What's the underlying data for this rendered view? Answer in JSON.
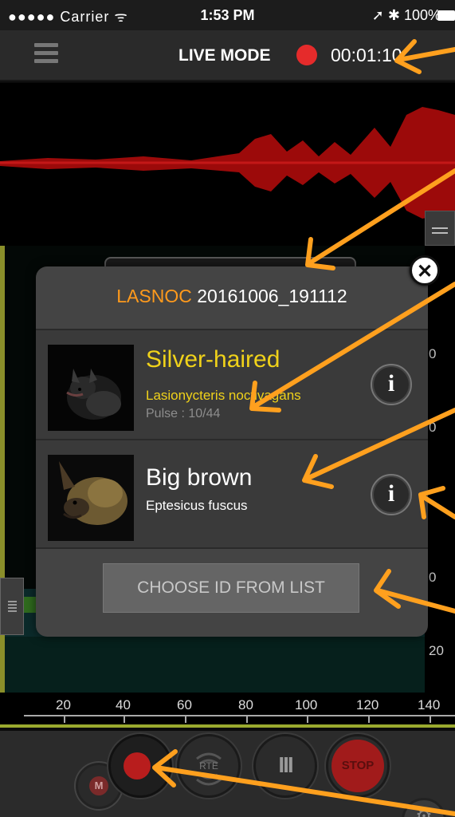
{
  "status_bar": {
    "carrier": "●●●●● Carrier",
    "wifi_glyph": "ᯤ",
    "time": "1:53 PM",
    "right": "➚ ✱ 100%"
  },
  "header": {
    "mode_label": "LIVE MODE",
    "timer": "00:01:10"
  },
  "frequency_scale": [
    "0",
    "0",
    "0",
    "20"
  ],
  "time_axis": [
    "20",
    "40",
    "60",
    "80",
    "100",
    "120",
    "140"
  ],
  "modal": {
    "code": "LASNOC",
    "file": "20161006_191112",
    "close_glyph": "✕",
    "species": [
      {
        "common": "Silver-haired",
        "scientific": "Lasionycteris noctivagans",
        "pulse": "Pulse : 10/44",
        "info": "i"
      },
      {
        "common": "Big brown",
        "scientific": "Eptesicus fuscus",
        "info": "i"
      }
    ],
    "choose_label": "CHOOSE ID FROM LIST"
  },
  "toolbar": {
    "m_label": "M",
    "rte_label": "RTE",
    "pause_glyph": "III",
    "stop_label": "STOP"
  },
  "colors": {
    "accent_orange": "#ff9a1c",
    "highlight_yellow": "#f0d21a",
    "record_red": "#e52b2b",
    "waveform_red": "#9c0a0a"
  }
}
